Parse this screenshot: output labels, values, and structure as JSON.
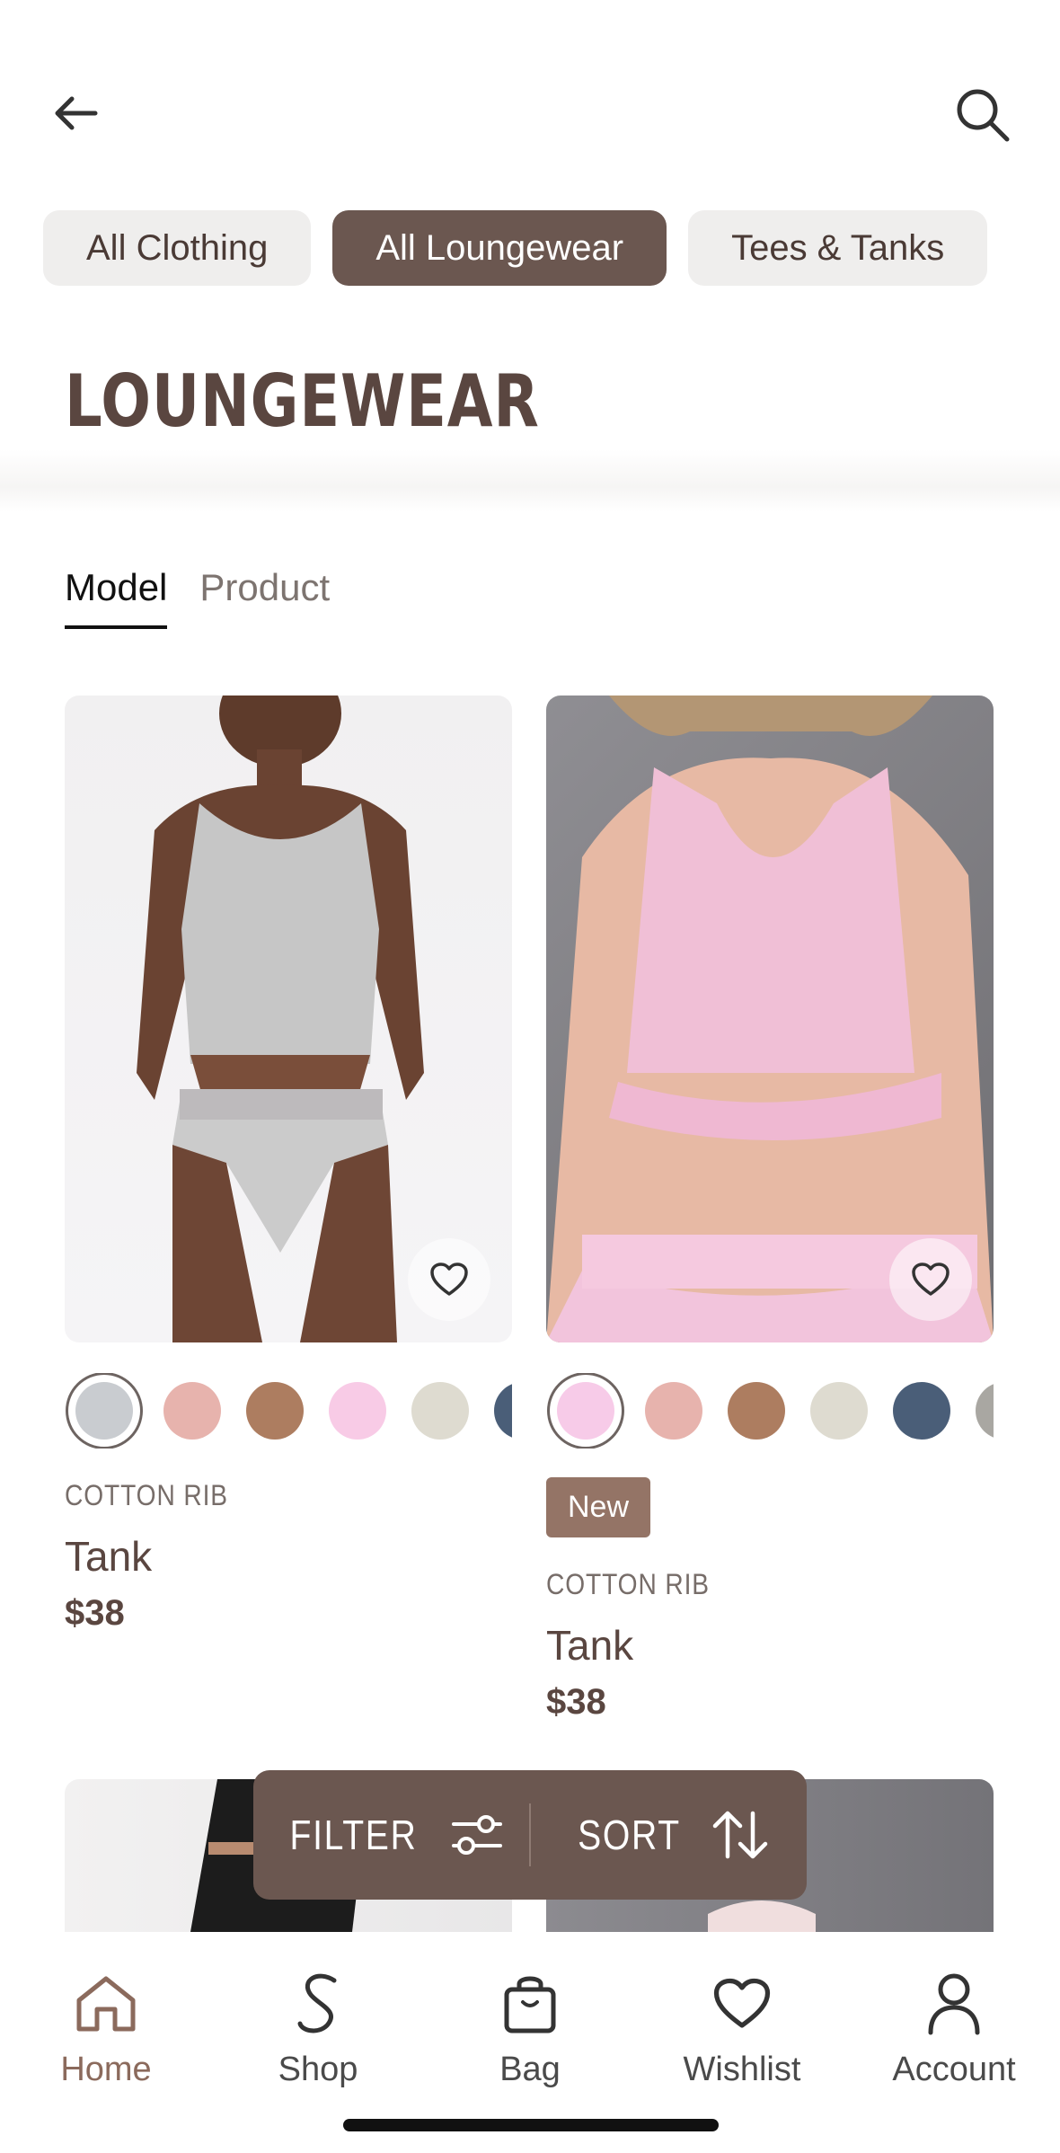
{
  "header": {
    "back_icon": "arrow-left-icon",
    "search_icon": "search-icon"
  },
  "categories": [
    {
      "label": "All Clothing",
      "active": false
    },
    {
      "label": "All Loungewear",
      "active": true
    },
    {
      "label": "Tees & Tanks",
      "active": false
    }
  ],
  "page_title": "LOUNGEWEAR",
  "view_toggle": {
    "model": "Model",
    "product": "Product",
    "selected": "Model"
  },
  "products": [
    {
      "collection": "COTTON RIB",
      "name": "Tank",
      "price": "$38",
      "badge": "",
      "swatches": [
        "#c9ccd0",
        "#e7b3ad",
        "#ad7d60",
        "#f8cbe6",
        "#dedbd0",
        "#4a5e78"
      ],
      "selected_swatch": 0
    },
    {
      "collection": "COTTON RIB",
      "name": "Tank",
      "price": "$38",
      "badge": "New",
      "swatches": [
        "#f7cbe8",
        "#e7b3ad",
        "#ad7d60",
        "#dedbd0",
        "#4a5e78",
        "#a9a7a2"
      ],
      "selected_swatch": 0
    }
  ],
  "actions": {
    "filter": "FILTER",
    "sort": "SORT"
  },
  "nav": [
    {
      "label": "Home",
      "icon": "home-icon",
      "active": true
    },
    {
      "label": "Shop",
      "icon": "shop-s-icon",
      "active": false
    },
    {
      "label": "Bag",
      "icon": "bag-icon",
      "active": false
    },
    {
      "label": "Wishlist",
      "icon": "heart-icon",
      "active": false
    },
    {
      "label": "Account",
      "icon": "user-icon",
      "active": false
    }
  ],
  "colors": {
    "accent": "#6b5750",
    "badge": "#947466",
    "active_nav": "#8b6a5c"
  }
}
